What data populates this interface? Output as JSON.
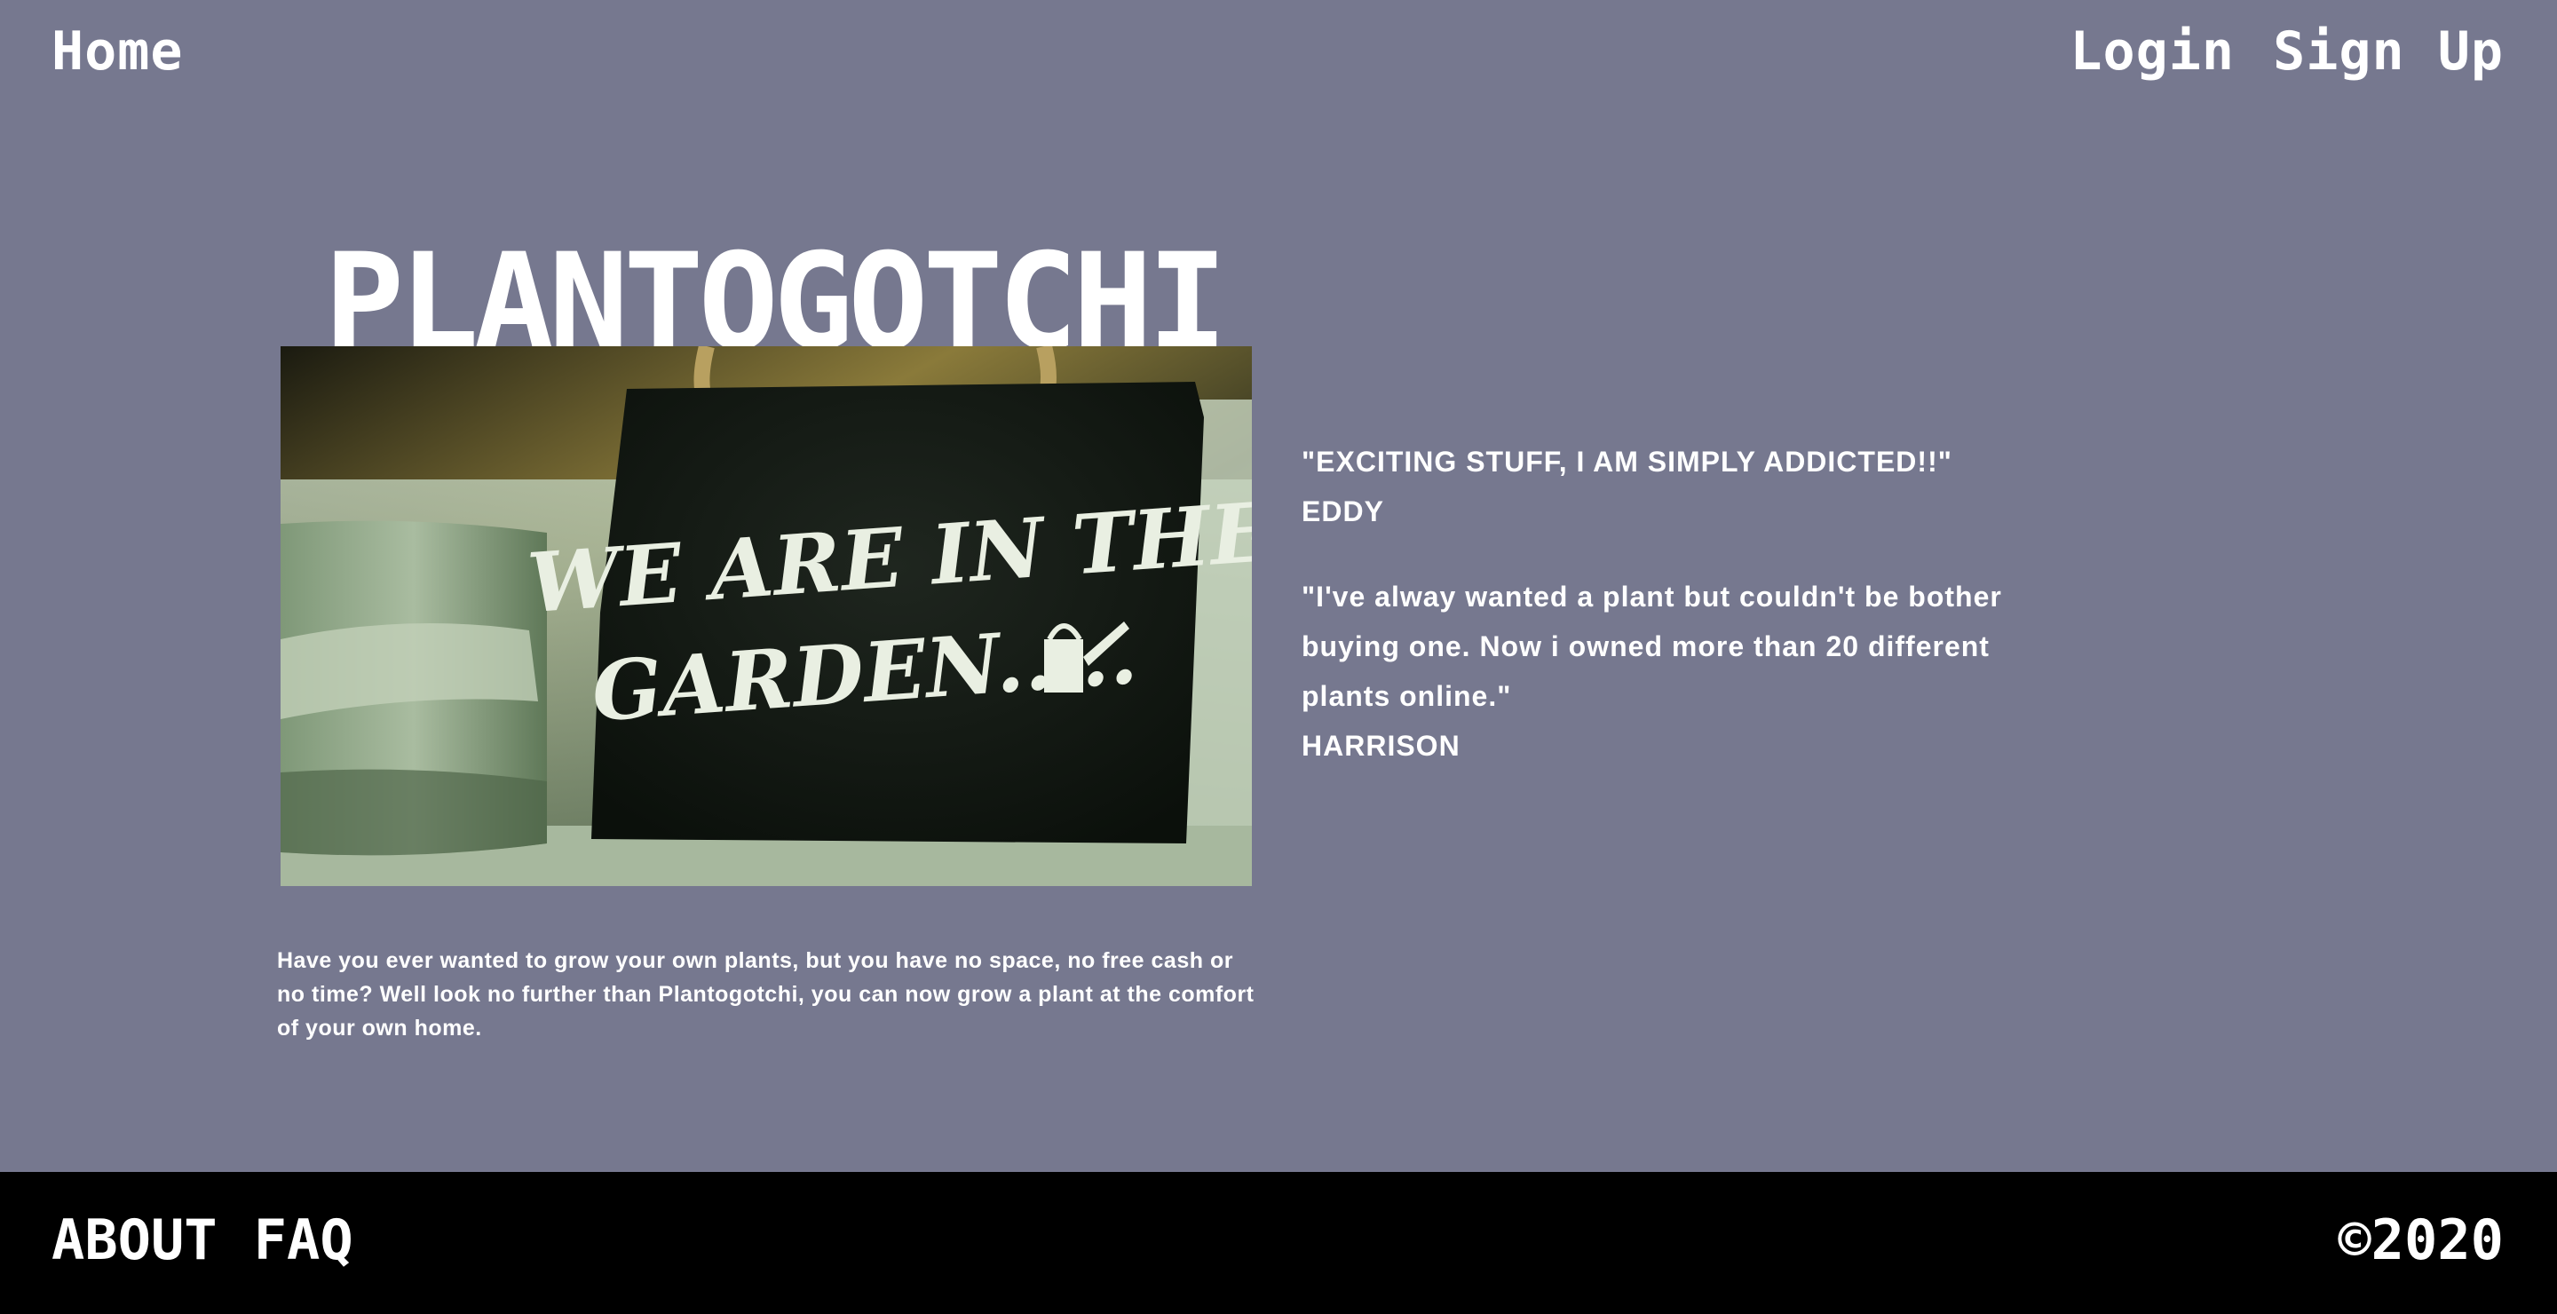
{
  "nav": {
    "home": "Home",
    "login": "Login",
    "signup": "Sign Up"
  },
  "brand": {
    "title": "PLANTOGOTCHI"
  },
  "hero": {
    "sign_line1": "WE ARE IN THE",
    "sign_line2": "GARDEN....."
  },
  "intro": {
    "text": "Have you ever wanted to grow your own plants, but you have no space, no free cash or no time? Well look no further than Plantogotchi, you can now grow a plant at the comfort of your own home."
  },
  "testimonials": [
    {
      "quote": "\"EXCITING STUFF, I AM SIMPLY ADDICTED!!\"",
      "author": "EDDY"
    },
    {
      "quote": "\"I've alway wanted a plant but couldn't be bother buying one. Now i owned more than 20 different plants online.\"",
      "author": "HARRISON"
    }
  ],
  "footer": {
    "about": "ABOUT",
    "faq": "FAQ",
    "copyright": "©2020"
  },
  "colors": {
    "background": "#76788f",
    "footer": "#000000",
    "text": "#ffffff"
  }
}
